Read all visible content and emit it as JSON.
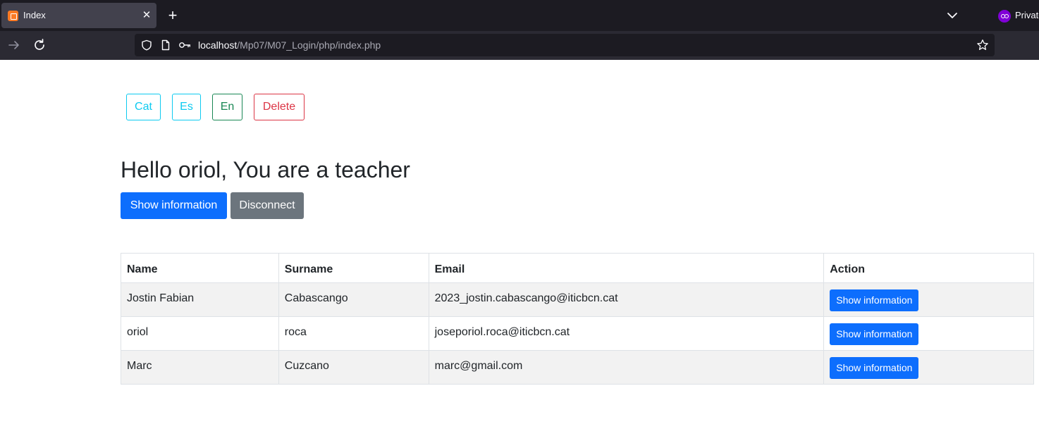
{
  "browser": {
    "tab_title": "Index",
    "tab_close": "✕",
    "new_tab": "+",
    "private_label": "Private",
    "url_host": "localhost",
    "url_path": "/Mp07/M07_Login/php/index.php"
  },
  "language_buttons": {
    "cat": "Cat",
    "es": "Es",
    "en": "En",
    "delete": "Delete"
  },
  "greeting": "Hello oriol, You are a teacher",
  "actions": {
    "show_information": "Show information",
    "disconnect": "Disconnect"
  },
  "table": {
    "headers": [
      "Name",
      "Surname",
      "Email",
      "Action"
    ],
    "rows": [
      {
        "name": "Jostin Fabian",
        "surname": "Cabascango",
        "email": "2023_jostin.cabascango@iticbcn.cat",
        "action": "Show information"
      },
      {
        "name": "oriol",
        "surname": "roca",
        "email": "joseporiol.roca@iticbcn.cat",
        "action": "Show information"
      },
      {
        "name": "Marc",
        "surname": "Cuzcano",
        "email": "marc@gmail.com",
        "action": "Show information"
      }
    ]
  },
  "colors": {
    "primary": "#0d6efd",
    "secondary": "#6c757d",
    "info": "#0dcaf0",
    "success": "#198754",
    "danger": "#dc3545",
    "chrome_dark": "#1c1b22",
    "chrome_toolbar": "#2b2a33"
  },
  "icons": [
    "xampp-favicon-icon",
    "close-icon",
    "plus-icon",
    "chevron-down-icon",
    "private-mask-icon",
    "arrow-right-icon",
    "reload-icon",
    "shield-icon",
    "page-icon",
    "key-icon",
    "star-icon"
  ]
}
